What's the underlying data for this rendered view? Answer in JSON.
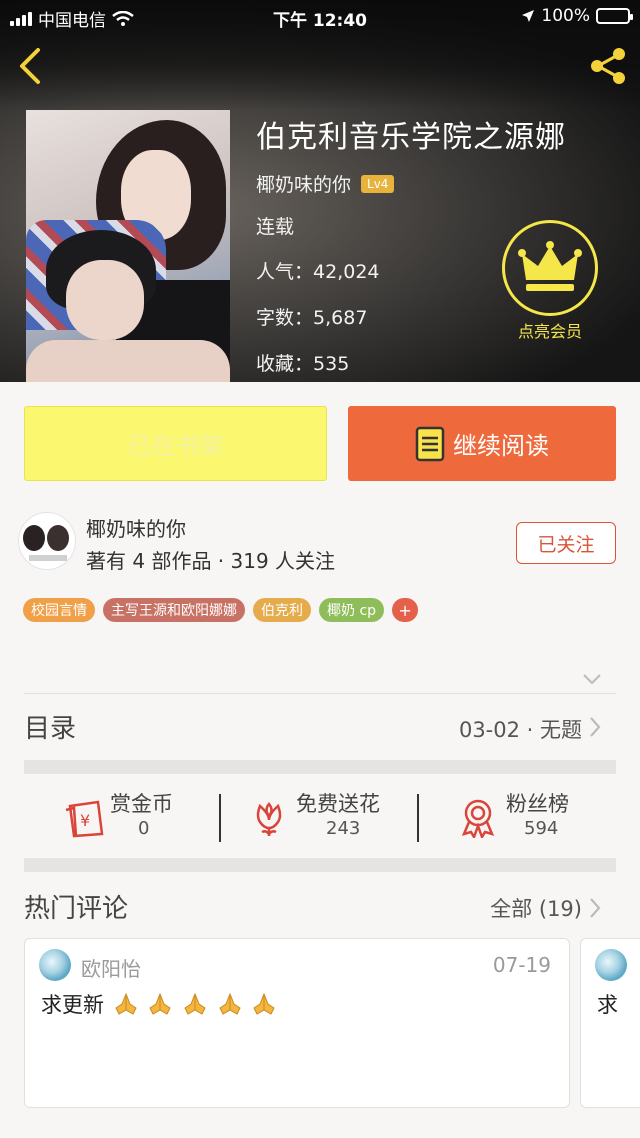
{
  "status_bar": {
    "carrier": "中国电信",
    "time": "下午 12:40",
    "battery": "100%"
  },
  "book": {
    "title": "伯克利音乐学院之源娜",
    "author": "椰奶味的你",
    "level": "Lv4",
    "status": "连载",
    "popularity_label": "人气：",
    "popularity": "42,024",
    "words_label": "字数：",
    "words": "5,687",
    "favorites_label": "收藏：",
    "favorites": "535"
  },
  "vip": {
    "label": "点亮会员"
  },
  "actions": {
    "shelf_label": "已在书架",
    "read_label": "继续阅读"
  },
  "author_card": {
    "name": "椰奶味的你",
    "stats": "著有 4 部作品 · 319 人关注",
    "follow_label": "已关注"
  },
  "tags": [
    {
      "label": "校园言情",
      "color": "#f0a048"
    },
    {
      "label": "主写王源和欧阳娜娜",
      "color": "#c87265"
    },
    {
      "label": "伯克利",
      "color": "#e6ab4b"
    },
    {
      "label": "椰奶 cp",
      "color": "#8fbd5a"
    }
  ],
  "tag_add": "+",
  "toc": {
    "label": "目录",
    "latest": "03-02 · 无题"
  },
  "stats": [
    {
      "label": "赏金币",
      "value": "0"
    },
    {
      "label": "免费送花",
      "value": "243"
    },
    {
      "label": "粉丝榜",
      "value": "594"
    }
  ],
  "comments": {
    "heading": "热门评论",
    "all_label": "全部 (19)",
    "items": [
      {
        "user": "欧阳怡",
        "date": "07-19",
        "text": "求更新"
      },
      {
        "text": "求"
      }
    ]
  },
  "colors": {
    "accent": "#ee6a3d",
    "vip_gold": "#f5e64a",
    "shelf_yellow": "#fbf86f",
    "icon_red": "#d9453a"
  }
}
